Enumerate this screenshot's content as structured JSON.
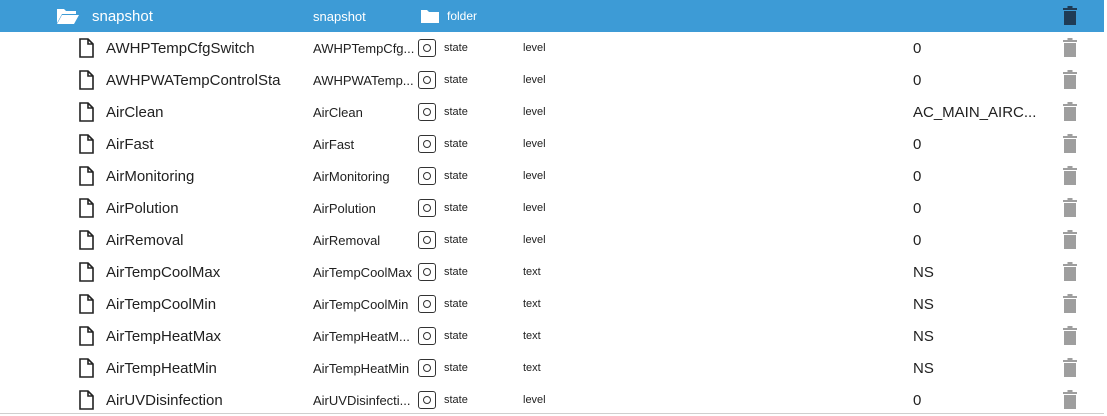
{
  "folder": {
    "name": "snapshot",
    "id": "snapshot",
    "type": "folder",
    "icon": "folder-open-icon"
  },
  "colors": {
    "folder_row": "#3d9bd6",
    "trash": "#9e9e9e"
  },
  "rows": [
    {
      "name": "AWHPTempCfgSwitch",
      "id": "AWHPTempCfg...",
      "role": "state",
      "vtype": "level",
      "value": "0"
    },
    {
      "name": "AWHPWATempControlSta",
      "id": "AWHPWATemp...",
      "role": "state",
      "vtype": "level",
      "value": "0"
    },
    {
      "name": "AirClean",
      "id": "AirClean",
      "role": "state",
      "vtype": "level",
      "value": "AC_MAIN_AIRC..."
    },
    {
      "name": "AirFast",
      "id": "AirFast",
      "role": "state",
      "vtype": "level",
      "value": "0"
    },
    {
      "name": "AirMonitoring",
      "id": "AirMonitoring",
      "role": "state",
      "vtype": "level",
      "value": "0"
    },
    {
      "name": "AirPolution",
      "id": "AirPolution",
      "role": "state",
      "vtype": "level",
      "value": "0"
    },
    {
      "name": "AirRemoval",
      "id": "AirRemoval",
      "role": "state",
      "vtype": "level",
      "value": "0"
    },
    {
      "name": "AirTempCoolMax",
      "id": "AirTempCoolMax",
      "role": "state",
      "vtype": "text",
      "value": "NS"
    },
    {
      "name": "AirTempCoolMin",
      "id": "AirTempCoolMin",
      "role": "state",
      "vtype": "text",
      "value": "NS"
    },
    {
      "name": "AirTempHeatMax",
      "id": "AirTempHeatM...",
      "role": "state",
      "vtype": "text",
      "value": "NS"
    },
    {
      "name": "AirTempHeatMin",
      "id": "AirTempHeatMin",
      "role": "state",
      "vtype": "text",
      "value": "NS"
    },
    {
      "name": "AirUVDisinfection",
      "id": "AirUVDisinfecti...",
      "role": "state",
      "vtype": "level",
      "value": "0"
    }
  ]
}
